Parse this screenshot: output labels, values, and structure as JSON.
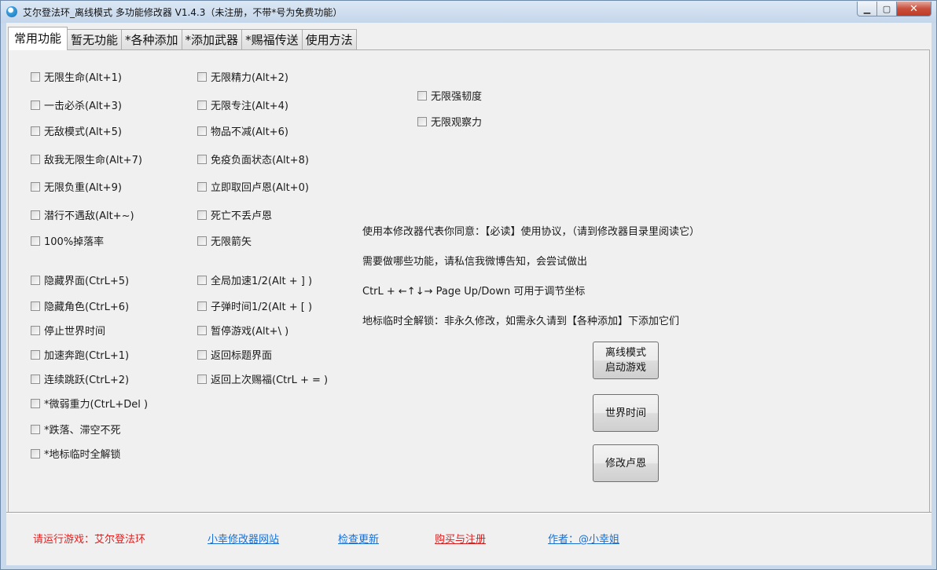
{
  "window": {
    "title": "艾尔登法环_离线模式 多功能修改器  V1.4.3（未注册，不带*号为免费功能）",
    "controls": {
      "minimize": "▁",
      "maximize": "▢",
      "close": "✕"
    }
  },
  "tabs": [
    {
      "label": "常用功能",
      "active": true
    },
    {
      "label": "暂无功能",
      "active": false
    },
    {
      "label": "*各种添加",
      "active": false
    },
    {
      "label": "*添加武器",
      "active": false
    },
    {
      "label": "*赐福传送",
      "active": false
    },
    {
      "label": "使用方法",
      "active": false
    }
  ],
  "checkboxes": {
    "col1": [
      "无限生命(Alt+1)",
      "一击必杀(Alt+3)",
      "无敌模式(Alt+5)",
      "敌我无限生命(Alt+7)",
      "无限负重(Alt+9)",
      "潜行不遇敌(Alt+~)",
      "100%掉落率",
      "隐藏界面(CtrL+5)",
      "隐藏角色(CtrL+6)",
      "停止世界时间",
      "加速奔跑(CtrL+1)",
      "连续跳跃(CtrL+2)",
      "*微弱重力(CtrL+Del )",
      "*跌落、滞空不死",
      "*地标临时全解锁"
    ],
    "col2": [
      "无限精力(Alt+2)",
      "无限专注(Alt+4)",
      "物品不减(Alt+6)",
      "免疫负面状态(Alt+8)",
      "立即取回卢恩(Alt+0)",
      "死亡不丢卢恩",
      "无限箭矢",
      "全局加速1/2(Alt + ] )",
      "子弹时间1/2(Alt + [ )",
      "暂停游戏(Alt+\\ )",
      "返回标题界面",
      "返回上次赐福(CtrL + = )"
    ],
    "col3": [
      "无限强韧度",
      "无限观察力"
    ]
  },
  "info_lines": [
    "使用本修改器代表你同意：【必读】使用协议，（请到修改器目录里阅读它）",
    "需要做哪些功能，请私信我微博告知，会尝试做出",
    "CtrL + ←↑↓→ Page Up/Down 可用于调节坐标",
    "地标临时全解锁：非永久修改，如需永久请到【各种添加】下添加它们"
  ],
  "buttons": {
    "offline_line1": "离线模式",
    "offline_line2": "启动游戏",
    "world_time": "世界时间",
    "modify_runes": "修改卢恩"
  },
  "footer": {
    "status": "请运行游戏：艾尔登法环",
    "site": "小幸修改器网站",
    "update": "检查更新",
    "buy": "购买与注册",
    "author": "作者：@小幸姐"
  },
  "colors": {
    "status_red": "#e02020",
    "buy_red": "#d81e1e",
    "link_blue": "#1a6fd1"
  }
}
